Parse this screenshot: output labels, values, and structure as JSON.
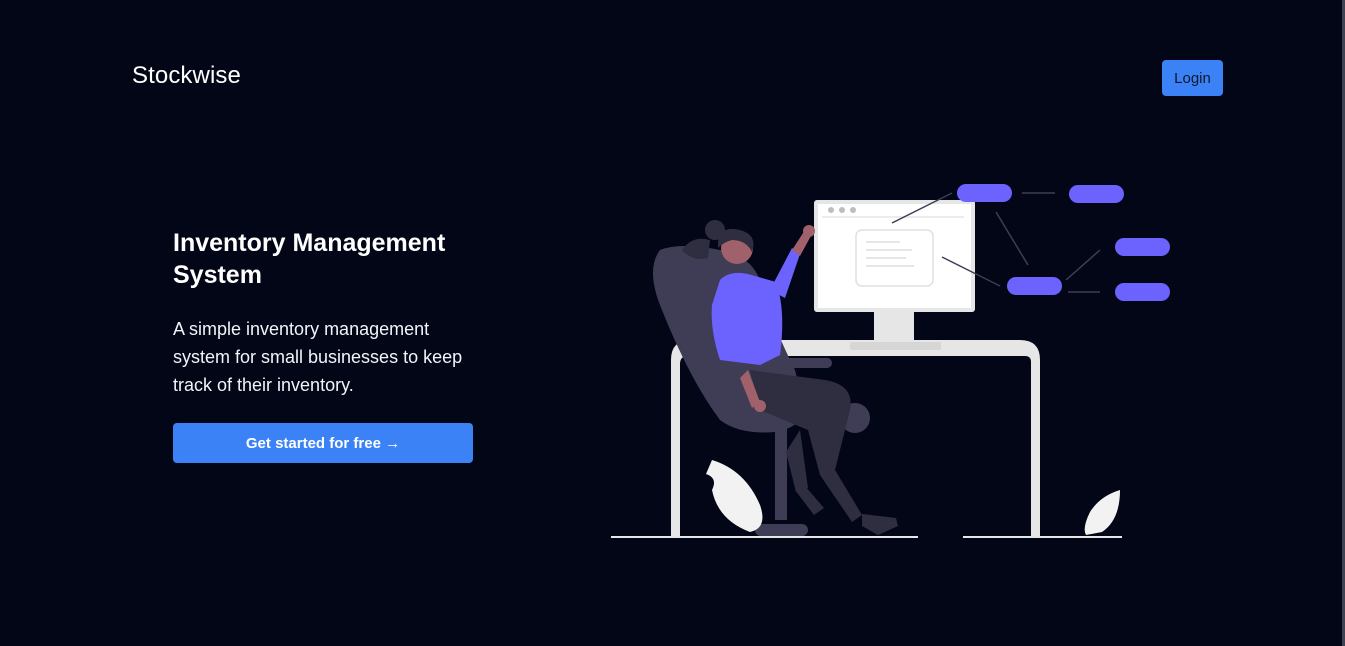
{
  "header": {
    "brand": "Stockwise",
    "login_label": "Login"
  },
  "hero": {
    "title": "Inventory Management System",
    "description": "A simple inventory management system for small businesses to keep track of their inventory.",
    "cta_label": "Get started for free →"
  },
  "colors": {
    "background": "#020617",
    "accent": "#3b82f6",
    "illustration_accent": "#6c63ff"
  },
  "illustration": {
    "subject": "person-at-desk-with-monitor-and-flow-nodes"
  }
}
